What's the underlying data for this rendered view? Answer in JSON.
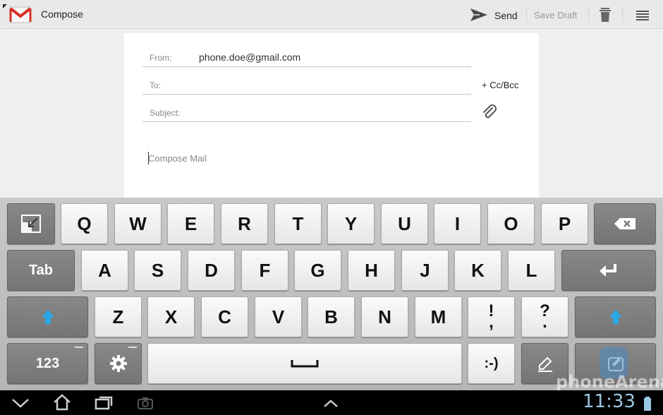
{
  "action_bar": {
    "title": "Compose",
    "send_label": "Send",
    "save_draft_label": "Save Draft"
  },
  "compose": {
    "from_label": "From:",
    "from_value": "phone.doe@gmail.com",
    "to_label": "To:",
    "cc_bcc_label": "+ Cc/Bcc",
    "subject_label": "Subject:",
    "body_placeholder": "Compose Mail"
  },
  "keyboard": {
    "row1": [
      "Q",
      "W",
      "E",
      "R",
      "T",
      "Y",
      "U",
      "I",
      "O",
      "P"
    ],
    "row2": [
      "A",
      "S",
      "D",
      "F",
      "G",
      "H",
      "J",
      "K",
      "L"
    ],
    "row3": [
      "Z",
      "X",
      "C",
      "V",
      "B",
      "N",
      "M"
    ],
    "tab_label": "Tab",
    "numbers_label": "123",
    "excl_top": "!",
    "excl_bottom": ",",
    "quest_top": "?",
    "quest_bottom": ".",
    "smiley_label": ":-)"
  },
  "status_bar": {
    "time": "11:33"
  },
  "watermark": "phoneArena",
  "colors": {
    "shift_arrow": "#29a8e6",
    "key_light": "#f2f2f2",
    "key_dark": "#7e7e7e",
    "gmail_red": "#d93025",
    "clock": "#9ac8e4"
  }
}
